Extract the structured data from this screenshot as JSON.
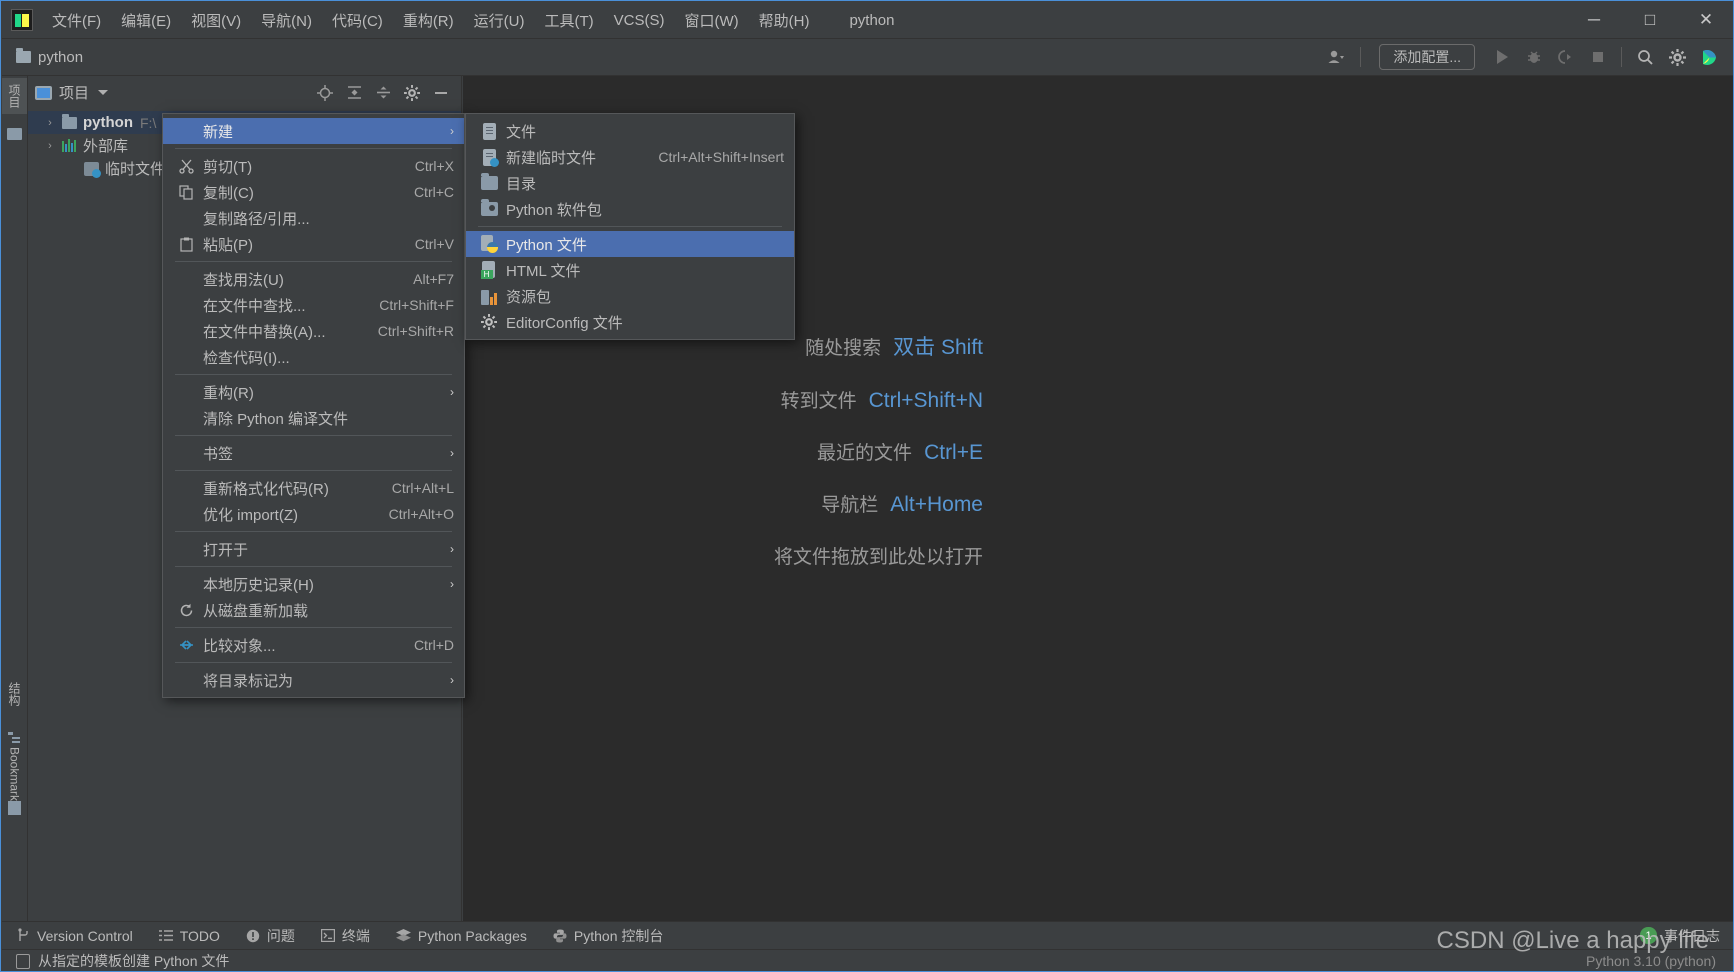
{
  "window": {
    "title": "python",
    "logo": "pycharm-logo",
    "controls": {
      "minimize": "─",
      "maximize": "□",
      "close": "✕"
    }
  },
  "menubar": {
    "items": [
      {
        "label": "文件(F)",
        "name": "menu-file"
      },
      {
        "label": "编辑(E)",
        "name": "menu-edit"
      },
      {
        "label": "视图(V)",
        "name": "menu-view"
      },
      {
        "label": "导航(N)",
        "name": "menu-navigate"
      },
      {
        "label": "代码(C)",
        "name": "menu-code"
      },
      {
        "label": "重构(R)",
        "name": "menu-refactor"
      },
      {
        "label": "运行(U)",
        "name": "menu-run"
      },
      {
        "label": "工具(T)",
        "name": "menu-tools"
      },
      {
        "label": "VCS(S)",
        "name": "menu-vcs"
      },
      {
        "label": "窗口(W)",
        "name": "menu-window"
      },
      {
        "label": "帮助(H)",
        "name": "menu-help"
      }
    ]
  },
  "toolbar": {
    "breadcrumb": "python",
    "add_config_label": "添加配置...",
    "icons": [
      "user-avatar-icon",
      "run-icon",
      "debug-icon",
      "run-coverage-icon",
      "stop-icon",
      "search-icon",
      "settings-gear-icon",
      "updates-icon"
    ]
  },
  "left_stripe": {
    "project_label": "项目",
    "structure_label": "结构",
    "bookmarks_label": "Bookmarks"
  },
  "project_panel": {
    "title": "项目",
    "header_icons": [
      "locate-icon",
      "expand-all-icon",
      "collapse-all-icon",
      "settings-gear-icon",
      "hide-icon"
    ],
    "tree": [
      {
        "name": "python",
        "path": "F:\\",
        "icon": "folder-icon",
        "selected": true,
        "twisty": "›"
      },
      {
        "name": "外部库",
        "path": "",
        "icon": "library-icon",
        "selected": false,
        "twisty": "›"
      },
      {
        "name": "临时文件和控",
        "path": "",
        "icon": "scratches-icon",
        "selected": false,
        "twisty": ""
      }
    ]
  },
  "editor": {
    "hints": [
      {
        "label": "随处搜索",
        "key": "双击 Shift"
      },
      {
        "label": "转到文件",
        "key": "Ctrl+Shift+N"
      },
      {
        "label": "最近的文件",
        "key": "Ctrl+E"
      },
      {
        "label": "导航栏",
        "key": "Alt+Home"
      }
    ],
    "drop_hint": "将文件拖放到此处以打开"
  },
  "context_menu": {
    "items": [
      {
        "label": "新建",
        "shortcut": "",
        "icon": "",
        "submenu": true,
        "highlighted": true,
        "name": "ctx-new"
      },
      {
        "separator": true
      },
      {
        "label": "剪切(T)",
        "shortcut": "Ctrl+X",
        "icon": "scissors-icon",
        "name": "ctx-cut"
      },
      {
        "label": "复制(C)",
        "shortcut": "Ctrl+C",
        "icon": "copy-icon",
        "name": "ctx-copy"
      },
      {
        "label": "复制路径/引用...",
        "shortcut": "",
        "icon": "",
        "name": "ctx-copy-path"
      },
      {
        "label": "粘贴(P)",
        "shortcut": "Ctrl+V",
        "icon": "paste-icon",
        "name": "ctx-paste"
      },
      {
        "separator": true
      },
      {
        "label": "查找用法(U)",
        "shortcut": "Alt+F7",
        "icon": "",
        "name": "ctx-find-usages"
      },
      {
        "label": "在文件中查找...",
        "shortcut": "Ctrl+Shift+F",
        "icon": "",
        "name": "ctx-find-in-files"
      },
      {
        "label": "在文件中替换(A)...",
        "shortcut": "Ctrl+Shift+R",
        "icon": "",
        "name": "ctx-replace-in-files"
      },
      {
        "label": "检查代码(I)...",
        "shortcut": "",
        "icon": "",
        "name": "ctx-inspect-code"
      },
      {
        "separator": true
      },
      {
        "label": "重构(R)",
        "shortcut": "",
        "icon": "",
        "submenu": true,
        "name": "ctx-refactor"
      },
      {
        "label": "清除 Python 编译文件",
        "shortcut": "",
        "icon": "",
        "name": "ctx-clean-pyc"
      },
      {
        "separator": true
      },
      {
        "label": "书签",
        "shortcut": "",
        "icon": "",
        "submenu": true,
        "name": "ctx-bookmarks"
      },
      {
        "separator": true
      },
      {
        "label": "重新格式化代码(R)",
        "shortcut": "Ctrl+Alt+L",
        "icon": "",
        "name": "ctx-reformat-code"
      },
      {
        "label": "优化 import(Z)",
        "shortcut": "Ctrl+Alt+O",
        "icon": "",
        "name": "ctx-optimize-imports"
      },
      {
        "separator": true
      },
      {
        "label": "打开于",
        "shortcut": "",
        "icon": "",
        "submenu": true,
        "name": "ctx-open-in"
      },
      {
        "separator": true
      },
      {
        "label": "本地历史记录(H)",
        "shortcut": "",
        "icon": "",
        "submenu": true,
        "name": "ctx-local-history"
      },
      {
        "label": "从磁盘重新加载",
        "shortcut": "",
        "icon": "reload-icon",
        "name": "ctx-reload-from-disk"
      },
      {
        "separator": true
      },
      {
        "label": "比较对象...",
        "shortcut": "Ctrl+D",
        "icon": "compare-icon",
        "name": "ctx-compare-with"
      },
      {
        "separator": true
      },
      {
        "label": "将目录标记为",
        "shortcut": "",
        "icon": "",
        "submenu": true,
        "name": "ctx-mark-directory-as"
      }
    ]
  },
  "submenu": {
    "items": [
      {
        "label": "文件",
        "shortcut": "",
        "icon": "file-icon",
        "name": "new-file"
      },
      {
        "label": "新建临时文件",
        "shortcut": "Ctrl+Alt+Shift+Insert",
        "icon": "scratch-file-icon",
        "name": "new-scratch-file"
      },
      {
        "label": "目录",
        "shortcut": "",
        "icon": "directory-icon",
        "name": "new-directory"
      },
      {
        "label": "Python 软件包",
        "shortcut": "",
        "icon": "python-package-icon",
        "name": "new-python-package"
      },
      {
        "separator": true
      },
      {
        "label": "Python 文件",
        "shortcut": "",
        "icon": "python-file-icon",
        "highlighted": true,
        "name": "new-python-file"
      },
      {
        "label": "HTML 文件",
        "shortcut": "",
        "icon": "html-file-icon",
        "name": "new-html-file"
      },
      {
        "label": "资源包",
        "shortcut": "",
        "icon": "resource-bundle-icon",
        "name": "new-resource-bundle"
      },
      {
        "label": "EditorConfig 文件",
        "shortcut": "",
        "icon": "editorconfig-icon",
        "name": "new-editorconfig-file"
      }
    ]
  },
  "bottom_tools": {
    "items": [
      {
        "label": "Version Control",
        "icon": "branch-icon",
        "name": "tool-version-control"
      },
      {
        "label": "TODO",
        "icon": "list-icon",
        "name": "tool-todo"
      },
      {
        "label": "问题",
        "icon": "warning-icon",
        "name": "tool-problems"
      },
      {
        "label": "终端",
        "icon": "terminal-icon",
        "name": "tool-terminal"
      },
      {
        "label": "Python Packages",
        "icon": "packages-icon",
        "name": "tool-python-packages"
      },
      {
        "label": "Python 控制台",
        "icon": "python-icon",
        "name": "tool-python-console"
      }
    ],
    "event_log": {
      "label": "事件日志",
      "count": "1"
    }
  },
  "statusbar": {
    "message": "从指定的模板创建 Python 文件",
    "interpreter": "Python 3.10 (python)"
  },
  "watermark": "CSDN @Live a happy life",
  "colors": {
    "accent": "#4b6eaf",
    "panel_bg": "#3c3f41",
    "editor_bg": "#2b2b2b",
    "text": "#bbbbbb",
    "link": "#5896d2",
    "badge_green": "#499c54"
  }
}
